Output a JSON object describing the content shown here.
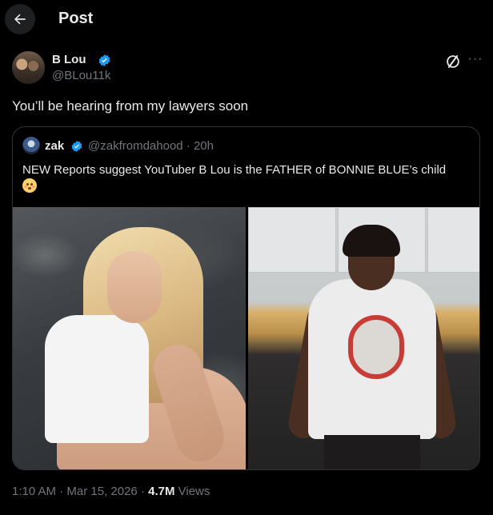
{
  "header": {
    "title": "Post",
    "back_icon": "arrow-left-icon"
  },
  "post": {
    "author": {
      "name": "B Lou",
      "handle": "@BLou11k",
      "verified": true
    },
    "text": "You’ll be hearing from my lawyers soon",
    "actions": {
      "grok_icon": "grok-icon",
      "more_icon": "more-icon",
      "more_label": "···"
    },
    "quoted": {
      "author": {
        "name": "zak",
        "handle": "@zakfromdahood",
        "time": "· 20h",
        "verified": true
      },
      "text": "NEW Reports suggest YouTuber B Lou is the FATHER of BONNIE BLUE’s child",
      "emoji": "flushed-face-emoji"
    },
    "meta": {
      "time": "1:10 AM",
      "sep1": " · ",
      "date": "Mar 15, 2026",
      "sep2": " · ",
      "views_count": "4.7M",
      "views_label": " Views"
    }
  },
  "colors": {
    "background": "#000000",
    "text": "#e7e9ea",
    "secondary": "#71767b",
    "verified": "#1d9bf0",
    "border": "#2f3336"
  }
}
